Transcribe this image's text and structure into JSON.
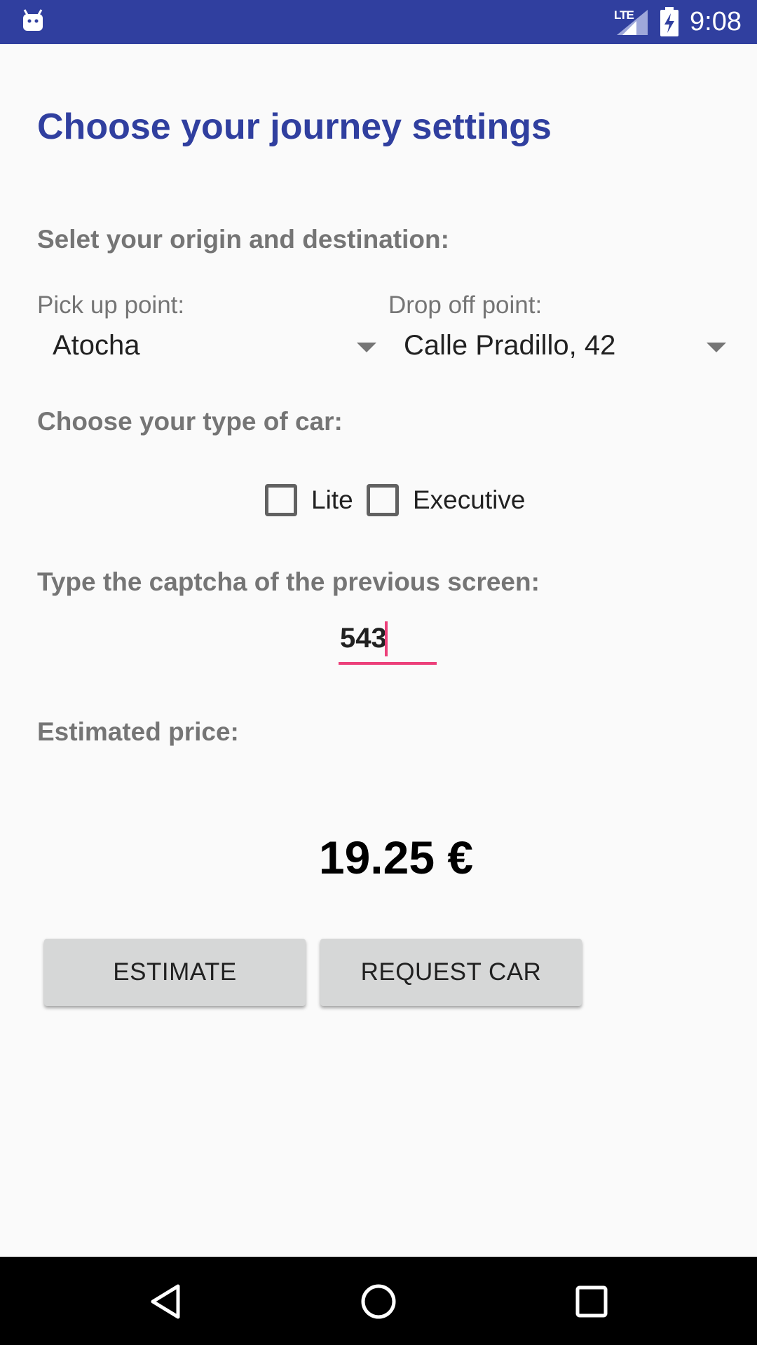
{
  "status_bar": {
    "network": "LTE",
    "time": "9:08"
  },
  "page": {
    "title": "Choose your journey settings",
    "origin_section_label": "Selet your origin and destination:",
    "pickup": {
      "label": "Pick up point:",
      "value": "Atocha"
    },
    "dropoff": {
      "label": "Drop off point:",
      "value": "Calle Pradillo, 42"
    },
    "car_section_label": "Choose your type of car:",
    "car_options": [
      {
        "label": "Lite",
        "checked": false
      },
      {
        "label": "Executive",
        "checked": false
      }
    ],
    "captcha_label": "Type the captcha of the previous screen:",
    "captcha_value": "543",
    "price_label": "Estimated price:",
    "price_value": "19.25 €",
    "buttons": {
      "estimate": "ESTIMATE",
      "request": "REQUEST CAR"
    }
  },
  "colors": {
    "primary_dark": "#303f9f",
    "accent": "#ec407a",
    "background": "#fafafa"
  }
}
